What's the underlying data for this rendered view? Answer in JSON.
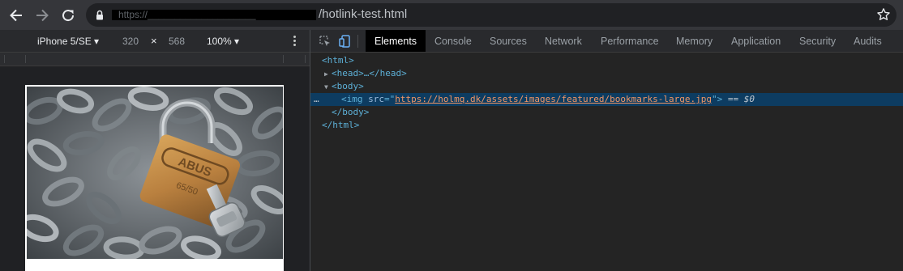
{
  "browser": {
    "url_hidden": "https://____________________",
    "url_visible": "/hotlink-test.html"
  },
  "device_toolbar": {
    "device": "iPhone 5/SE ▾",
    "width": "320",
    "times": "×",
    "height": "568",
    "zoom": "100% ▾"
  },
  "devtools": {
    "tabs": [
      {
        "label": "Elements",
        "active": true
      },
      {
        "label": "Console"
      },
      {
        "label": "Sources"
      },
      {
        "label": "Network"
      },
      {
        "label": "Performance"
      },
      {
        "label": "Memory"
      },
      {
        "label": "Application"
      },
      {
        "label": "Security"
      },
      {
        "label": "Audits"
      }
    ]
  },
  "dom": {
    "html_open": "<html>",
    "head": "<head>…</head>",
    "body_open": "<body>",
    "img_open": "<img ",
    "img_attr": "src",
    "img_eq": "=\"",
    "img_src": "https://holmq.dk/assets/images/featured/bookmarks-large.jpg",
    "img_close": "\">",
    "equals": " == ",
    "dollar_zero": "$0",
    "ellipsis": "…",
    "body_close": "</body>",
    "html_close": "</html>"
  },
  "colors": {
    "selected_row": "#0d3c61",
    "active_tab": "#000000",
    "tag": "#5db0d7",
    "attr_value": "#f29766"
  },
  "icons": [
    "back-arrow-icon",
    "forward-arrow-icon",
    "reload-icon",
    "lock-icon",
    "star-icon",
    "inspect-icon",
    "device-toggle-icon",
    "more-vert-icon"
  ]
}
